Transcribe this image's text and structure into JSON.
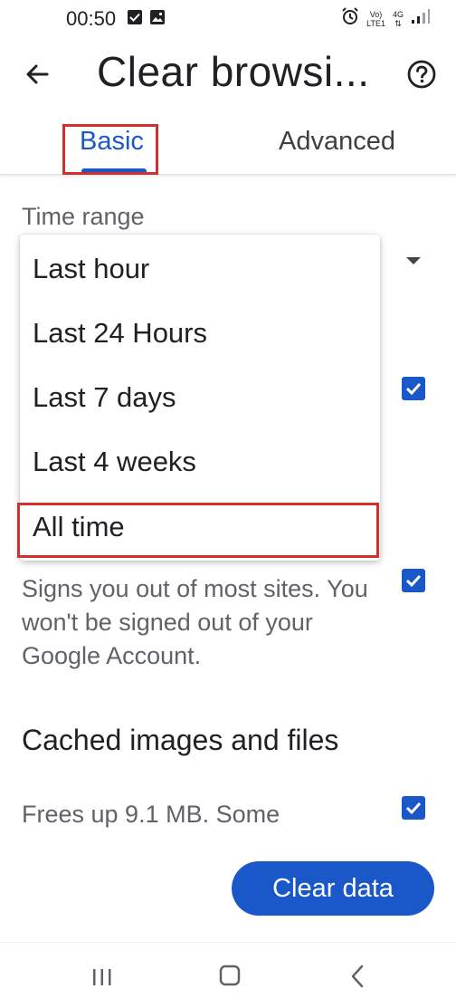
{
  "status_bar": {
    "time": "00:50",
    "network_top": "Vo)",
    "network_bottom": "LTE1",
    "network_type": "4G",
    "icons": [
      "check-box-icon",
      "image-icon",
      "alarm-icon",
      "data-arrows-icon",
      "signal-icon"
    ]
  },
  "app_bar": {
    "title": "Clear browsi...",
    "back_icon": "arrow-back-icon",
    "help_icon": "help-circle-icon"
  },
  "tabs": [
    {
      "label": "Basic",
      "selected": true
    },
    {
      "label": "Advanced",
      "selected": false
    }
  ],
  "time_range": {
    "label": "Time range",
    "options": [
      "Last hour",
      "Last 24 Hours",
      "Last 7 days",
      "Last 4 weeks",
      "All time"
    ],
    "highlighted_option": "All time"
  },
  "items": {
    "cookies_desc": "Signs you out of most sites. You won't be signed out of your Google Account.",
    "cache_title": "Cached images and files",
    "cache_desc": "Frees up 9.1 MB. Some"
  },
  "actions": {
    "clear_label": "Clear data"
  },
  "colors": {
    "accent": "#1a57c9",
    "highlight_box": "#d32f2f",
    "secondary_text": "#5f6368"
  }
}
